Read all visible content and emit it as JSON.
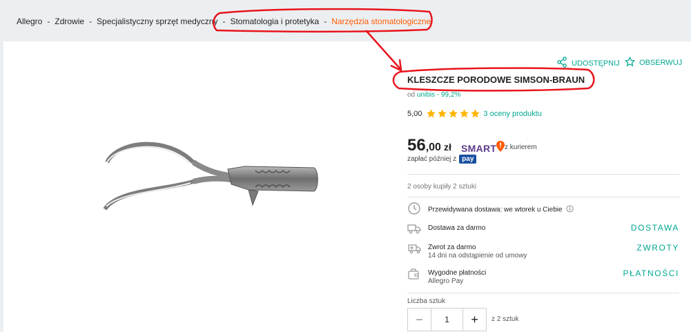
{
  "breadcrumb": {
    "items": [
      "Allegro",
      "Zdrowie",
      "Specjalistyczny sprzęt medyczny",
      "Stomatologia i protetyka",
      "Narzędzia stomatologiczne"
    ],
    "separator": "-"
  },
  "actions": {
    "share_label": "UDOSTĘPNIJ",
    "observe_label": "OBSERWUJ"
  },
  "product": {
    "title": "KLESZCZE PORODOWE SIMSON-BRAUN",
    "seller_prefix": "od",
    "seller_name": "unibis - 99,2%",
    "rating_score": "5,00",
    "rating_value": 5,
    "rating_max": 5,
    "rating_count": "3 oceny produktu",
    "price_int": "56",
    "price_dec": ",00",
    "price_cur": "zł",
    "smart_label": "SMART",
    "smart_courier": "z kurierem",
    "paylater_text": "zapłać później z",
    "pay_badge": "pay",
    "bought_text": "2 osoby kupiły 2 sztuki"
  },
  "delivery": {
    "estimate": "Przewidywana dostawa: we wtorek u Ciebie",
    "free_delivery": "Dostawa za darmo",
    "delivery_action": "DOSTAWA",
    "free_return": "Zwrot za darmo",
    "return_note": "14 dni na odstąpienie od umowy",
    "return_action": "ZWROTY",
    "payments": "Wygodne płatności",
    "payments_note": "Allegro Pay",
    "payments_action": "PŁATNOŚCI"
  },
  "quantity": {
    "label": "Liczba sztuk",
    "value": "1",
    "minus": "−",
    "plus": "+",
    "of_text": "z 2 sztuk"
  },
  "colors": {
    "accent": "#00a790",
    "star": "#ffb400",
    "annotation": "#e8141c",
    "breadcrumb_current": "#ff5a00"
  },
  "icons": [
    "share-icon",
    "star-outline-icon",
    "star-icon",
    "smart-pin-icon",
    "clock-icon",
    "truck-icon",
    "return-icon",
    "wallet-icon",
    "info-icon"
  ]
}
